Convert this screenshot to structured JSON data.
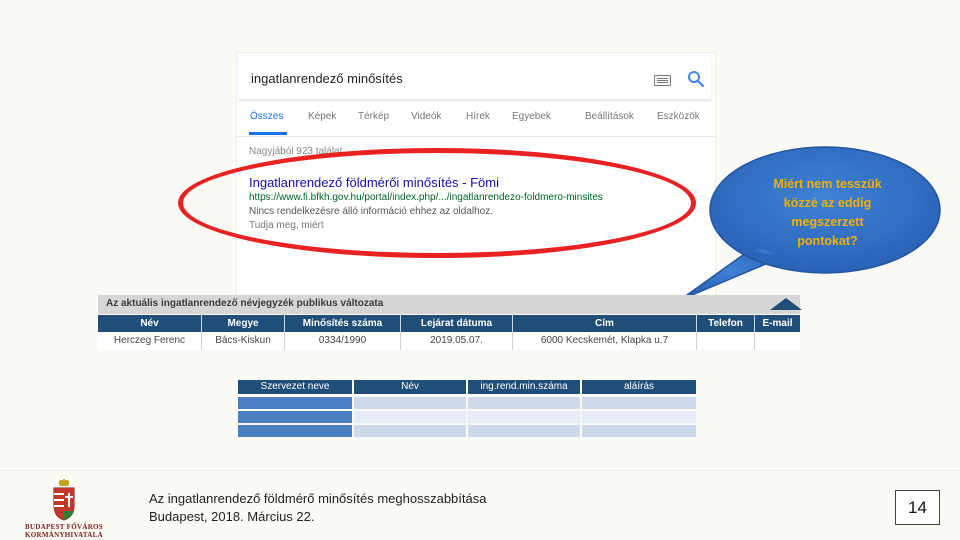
{
  "google": {
    "query": "ingatlanrendező minősítés",
    "tabs": [
      "Összes",
      "Képek",
      "Térkép",
      "Videók",
      "Hírek",
      "Egyebek",
      "Beállítások",
      "Eszközök"
    ],
    "stats": "Nagyjából 923 találat",
    "result": {
      "title": "Ingatlanrendező földmérői minősítés - Fömi",
      "url": "https://www.fi.bfkh.gov.hu/portal/index.php/.../ingatlanrendezo-foldmero-minsites",
      "snippet1": "Nincs rendelkezésre álló információ ehhez az oldalhoz.",
      "snippet2": "Tudja meg, miért"
    }
  },
  "bubble": {
    "lines": [
      "Miért nem tesszük",
      "közzé az eddig",
      "megszerzett",
      "pontokat?"
    ],
    "fill": "#2e6fc4",
    "text_color": "#f0b000"
  },
  "register": {
    "title": "Az aktuális ingatlanrendező névjegyzék publikus változata",
    "columns": [
      "Név",
      "Megye",
      "Minősítés száma",
      "Lejárat dátuma",
      "Cím",
      "Telefon",
      "E-mail"
    ],
    "rows": [
      [
        "Herczeg Ferenc",
        "Bács-Kiskun",
        "0334/1990",
        "2019.05.07.",
        "6000 Kecskemét, Klapka u.7",
        "",
        ""
      ]
    ]
  },
  "form": {
    "columns": [
      "Szervezet neve",
      "Név",
      "ing.rend.min.száma",
      "aláírás"
    ],
    "rows": 3
  },
  "footer": {
    "logo_line1": "BUDAPEST FŐVÁROS",
    "logo_line2": "KORMÁNYHIVATALA",
    "title": "Az ingatlanrendező földmérő minősítés meghosszabbítása",
    "subtitle": "Budapest, 2018. Március 22.",
    "page": "14"
  },
  "colors": {
    "annotation_red": "#e82222",
    "table_blue": "#1f4e79",
    "link_blue": "#1a0dab"
  }
}
